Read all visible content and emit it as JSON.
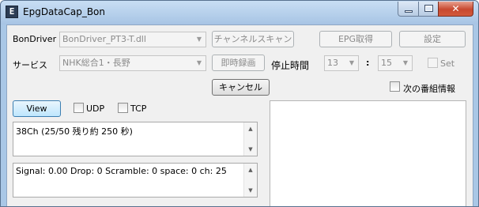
{
  "window": {
    "title": "EpgDataCap_Bon",
    "app_icon_glyph": "E",
    "minimize_glyph": "minimize",
    "maximize_glyph": "maximize",
    "close_glyph": "✕"
  },
  "row_driver": {
    "label": "BonDriver",
    "driver_value": "BonDriver_PT3-T.dll",
    "channel_scan_button": "チャンネルスキャン",
    "epg_button": "EPG取得",
    "settings_button": "設定"
  },
  "row_service": {
    "label": "サービス",
    "service_value": "NHK総合1・長野",
    "instant_record_button": "即時録画",
    "stop_time_label": "停止時間",
    "hour_value": "13",
    "separator": ":",
    "minute_value": "15",
    "set_label": "Set"
  },
  "cancel_button": "キャンセル",
  "next_program_label": "次の番組情報",
  "view_button": "View",
  "udp_label": "UDP",
  "tcp_label": "TCP",
  "status_box": {
    "text": "38Ch (25/50 残り約 250 秒)"
  },
  "signal_box": {
    "text": "Signal: 0.00 Drop: 0 Scramble: 0  space: 0 ch: 25"
  },
  "icons": {
    "dropdown_arrow": "▼",
    "scroll_up": "▲",
    "scroll_down": "▼"
  }
}
